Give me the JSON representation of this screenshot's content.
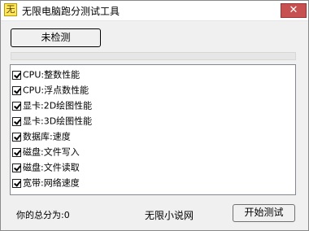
{
  "window": {
    "icon_glyph": "无",
    "title": "无限电脑跑分测试工具",
    "close_glyph": "✕"
  },
  "status_button": {
    "label": "未检测"
  },
  "progress": {
    "value_percent": 0
  },
  "tests": [
    {
      "label": "CPU:整数性能",
      "checked": true
    },
    {
      "label": "CPU:浮点数性能",
      "checked": true
    },
    {
      "label": "显卡:2D绘图性能",
      "checked": true
    },
    {
      "label": "显卡:3D绘图性能",
      "checked": true
    },
    {
      "label": "数据库:速度",
      "checked": true
    },
    {
      "label": "磁盘:文件写入",
      "checked": true
    },
    {
      "label": "磁盘:文件读取",
      "checked": true
    },
    {
      "label": "宽带:网络速度",
      "checked": true
    }
  ],
  "footer": {
    "score_text": "你的总分为:0",
    "watermark": "无限小说网",
    "start_button": "开始测试"
  },
  "colors": {
    "progress_fill": "#06b025",
    "close_button": "#c75050"
  }
}
